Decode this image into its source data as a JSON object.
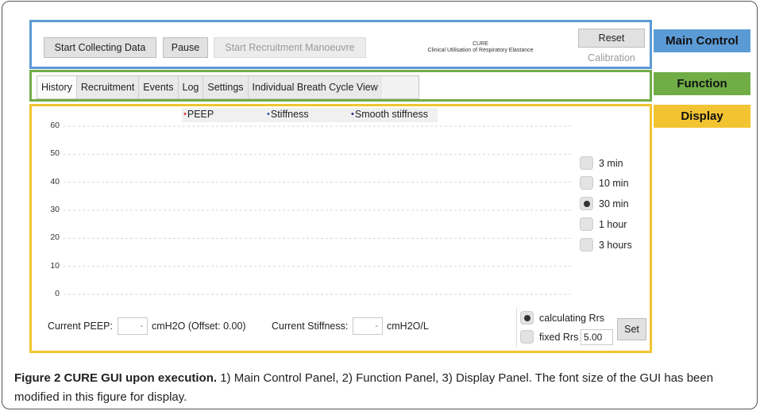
{
  "main_control": {
    "start_label": "Start Collecting Data",
    "pause_label": "Pause",
    "recruit_label": "Start Recruitment Manoeuvre",
    "app_name": "CURE",
    "app_subtitle": "Clinical Utilisation of Respiratory Elastance",
    "reset_label": "Reset",
    "calibration_label": "Calibration"
  },
  "panel_tags": {
    "main": "Main Control",
    "function": "Function",
    "display": "Display"
  },
  "tabs": [
    {
      "label": "History",
      "active": true
    },
    {
      "label": "Recruitment",
      "active": false
    },
    {
      "label": "Events",
      "active": false
    },
    {
      "label": "Log",
      "active": false
    },
    {
      "label": "Settings",
      "active": false
    },
    {
      "label": "Individual Breath Cycle View",
      "active": false
    }
  ],
  "chart_data": {
    "type": "line",
    "title": "",
    "xlabel": "",
    "ylabel": "",
    "ylim": [
      0,
      60
    ],
    "y_ticks": [
      "60",
      "50",
      "40",
      "30",
      "20",
      "10",
      "0"
    ],
    "grid": true,
    "legend_position": "top",
    "series": [
      {
        "name": "PEEP",
        "color": "#e53935",
        "values": []
      },
      {
        "name": "Stiffness",
        "color": "#3949ab",
        "values": []
      },
      {
        "name": "Smooth stiffness",
        "color": "#1a237e",
        "values": []
      }
    ]
  },
  "time_range": {
    "options": [
      {
        "label": "3 min",
        "selected": false
      },
      {
        "label": "10 min",
        "selected": false
      },
      {
        "label": "30 min",
        "selected": true
      },
      {
        "label": "1 hour",
        "selected": false
      },
      {
        "label": "3 hours",
        "selected": false
      }
    ]
  },
  "readouts": {
    "peep_label": "Current PEEP:",
    "peep_value": "-",
    "peep_unit": "cmH2O (Offset: 0.00)",
    "stiffness_label": "Current Stiffness:",
    "stiffness_value": "-",
    "stiffness_unit": "cmH2O/L"
  },
  "rrs": {
    "calculating_label": "calculating Rrs",
    "calculating_selected": true,
    "fixed_label": "fixed Rrs",
    "fixed_selected": false,
    "fixed_value": "5.00",
    "set_label": "Set"
  },
  "caption": {
    "bold": "Figure 2 CURE GUI upon execution.",
    "text": " 1) Main Control Panel, 2) Function Panel, 3) Display Panel. The font size of the GUI has been modified in this figure for display."
  },
  "colors": {
    "main_control": "#5b9bd5",
    "function": "#70ad47",
    "display": "#f3c432"
  }
}
